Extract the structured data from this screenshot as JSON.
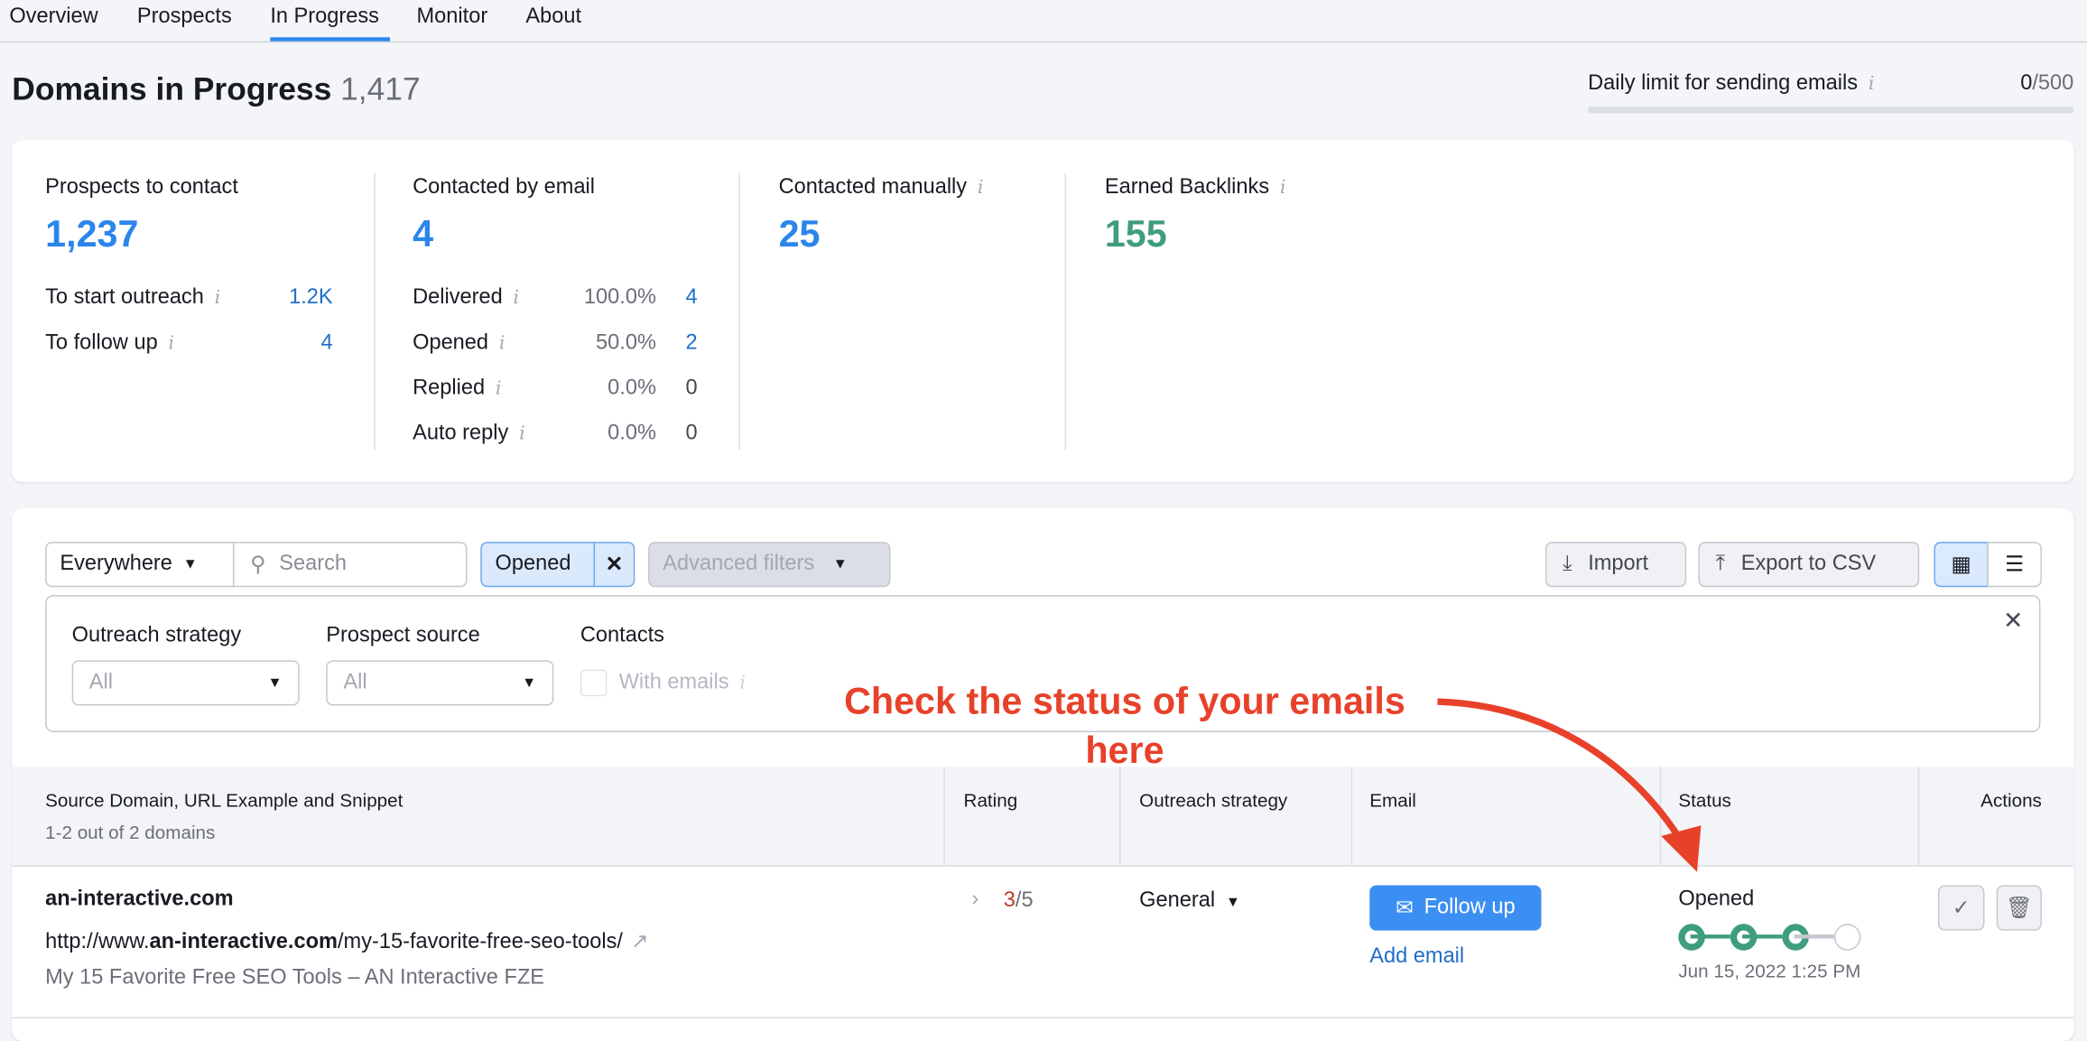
{
  "tabs": [
    "Overview",
    "Prospects",
    "In Progress",
    "Monitor",
    "About"
  ],
  "active_tab": "In Progress",
  "header": {
    "title": "Domains in Progress",
    "count": "1,417",
    "limit_label": "Daily limit for sending emails",
    "limit_used": "0",
    "limit_total": "/500",
    "limit_progress": 0
  },
  "stats": {
    "prospects": {
      "label": "Prospects to contact",
      "value": "1,237",
      "rows": [
        {
          "label": "To start outreach",
          "value": "1.2K"
        },
        {
          "label": "To follow up",
          "value": "4"
        }
      ]
    },
    "email": {
      "label": "Contacted by email",
      "value": "4",
      "rows": [
        {
          "label": "Delivered",
          "pct": "100.0%",
          "value": "4"
        },
        {
          "label": "Opened",
          "pct": "50.0%",
          "value": "2"
        },
        {
          "label": "Replied",
          "pct": "0.0%",
          "value": "0"
        },
        {
          "label": "Auto reply",
          "pct": "0.0%",
          "value": "0"
        }
      ]
    },
    "manual": {
      "label": "Contacted manually",
      "value": "25"
    },
    "backlinks": {
      "label": "Earned Backlinks",
      "value": "155"
    }
  },
  "toolbar": {
    "scope": "Everywhere",
    "search_placeholder": "Search",
    "chip": "Opened",
    "advanced": "Advanced filters",
    "import": "Import",
    "export": "Export to CSV"
  },
  "filters": {
    "strategy_label": "Outreach strategy",
    "strategy_value": "All",
    "source_label": "Prospect source",
    "source_value": "All",
    "contacts_label": "Contacts",
    "with_emails": "With emails"
  },
  "annotation": {
    "line1": "Check the status of your emails",
    "line2": "here",
    "color": "#e8412a"
  },
  "table": {
    "headers": {
      "source": "Source Domain, URL Example and Snippet",
      "source_sub": "1-2 out of 2 domains",
      "rating": "Rating",
      "strategy": "Outreach strategy",
      "email": "Email",
      "status": "Status",
      "actions": "Actions"
    },
    "rows": [
      {
        "domain": "an-interactive.com",
        "url_pre": "http://www.",
        "url_domain": "an-interactive.com",
        "url_path": "/my-15-favorite-free-seo-tools/",
        "snippet": "My 15 Favorite Free SEO Tools – AN Interactive FZE",
        "rating": "3",
        "rating_total": "/5",
        "strategy": "General",
        "email_button": "Follow up",
        "add_email": "Add email",
        "status": "Opened",
        "status_steps_done": 3,
        "status_steps_total": 4,
        "status_date": "Jun 15, 2022 1:25 PM"
      }
    ]
  }
}
